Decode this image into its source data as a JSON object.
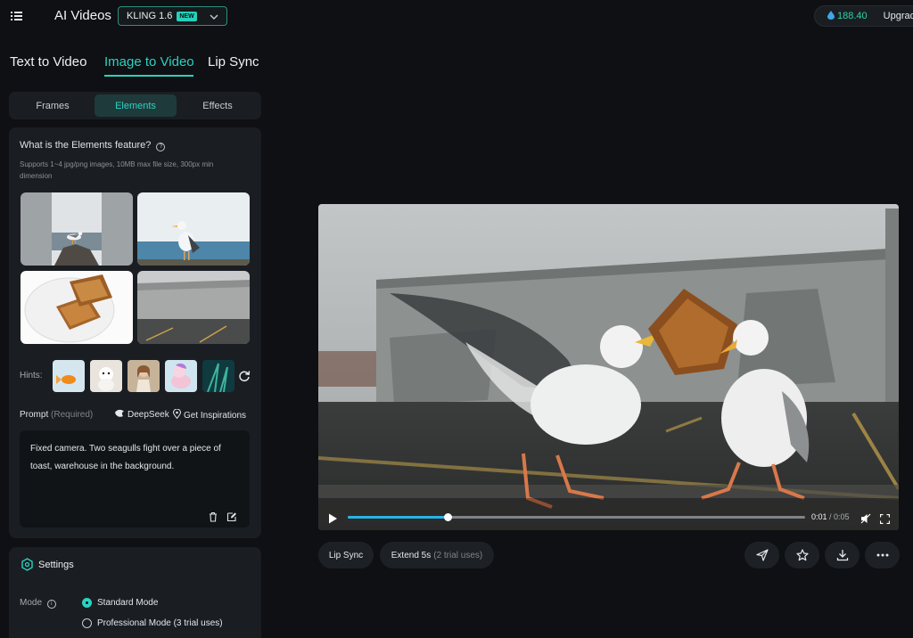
{
  "header": {
    "title": "AI Videos",
    "model": "KLING 1.6",
    "model_badge": "NEW",
    "credits": "188.40",
    "upgrade": "Upgrade"
  },
  "mode_tabs": [
    "Text to Video",
    "Image to Video",
    "Lip Sync"
  ],
  "active_mode_tab": "Image to Video",
  "sub_tabs": [
    "Frames",
    "Elements",
    "Effects"
  ],
  "active_sub_tab": "Elements",
  "elements_panel": {
    "title": "What is the Elements feature?",
    "description": "Supports 1~4 jpg/png images, 10MB max file size, 300px min dimension",
    "images": [
      "seagull-on-rock",
      "seagull-standing",
      "toast-on-plate",
      "warehouse-lot"
    ],
    "hints_label": "Hints:",
    "hints": [
      "goldfish",
      "puppy",
      "woman",
      "cartoon-pony",
      "underwater-plant"
    ],
    "prompt_label": "Prompt",
    "prompt_required": "(Required)",
    "deepseek": "DeepSeek",
    "inspirations": "Get Inspirations",
    "prompt_text": "Fixed camera. Two seagulls fight over a piece of toast, warehouse in the background."
  },
  "settings": {
    "title": "Settings",
    "mode_label": "Mode",
    "modes": [
      "Standard Mode",
      "Professional Mode (3 trial uses)"
    ],
    "selected_mode": "Standard Mode"
  },
  "player": {
    "current_time": "0:01",
    "duration": "/ 0:05",
    "progress": 0.22
  },
  "actions": {
    "lip_sync": "Lip Sync",
    "extend": "Extend 5s",
    "extend_note": "(2 trial uses)"
  },
  "icons": {
    "menu": "menu-icon",
    "chevron": "chevron-down-icon",
    "credit": "water-drop-icon",
    "refresh": "refresh-icon",
    "delete": "trash-icon",
    "edit": "edit-icon",
    "settings": "hexagon-settings-icon",
    "play": "play-icon",
    "share": "send-icon",
    "favorite": "star-icon",
    "download": "download-icon",
    "more": "more-icon"
  },
  "colors": {
    "accent": "#2cd2c2",
    "background": "#0e1013",
    "panel": "#1a1e22"
  }
}
